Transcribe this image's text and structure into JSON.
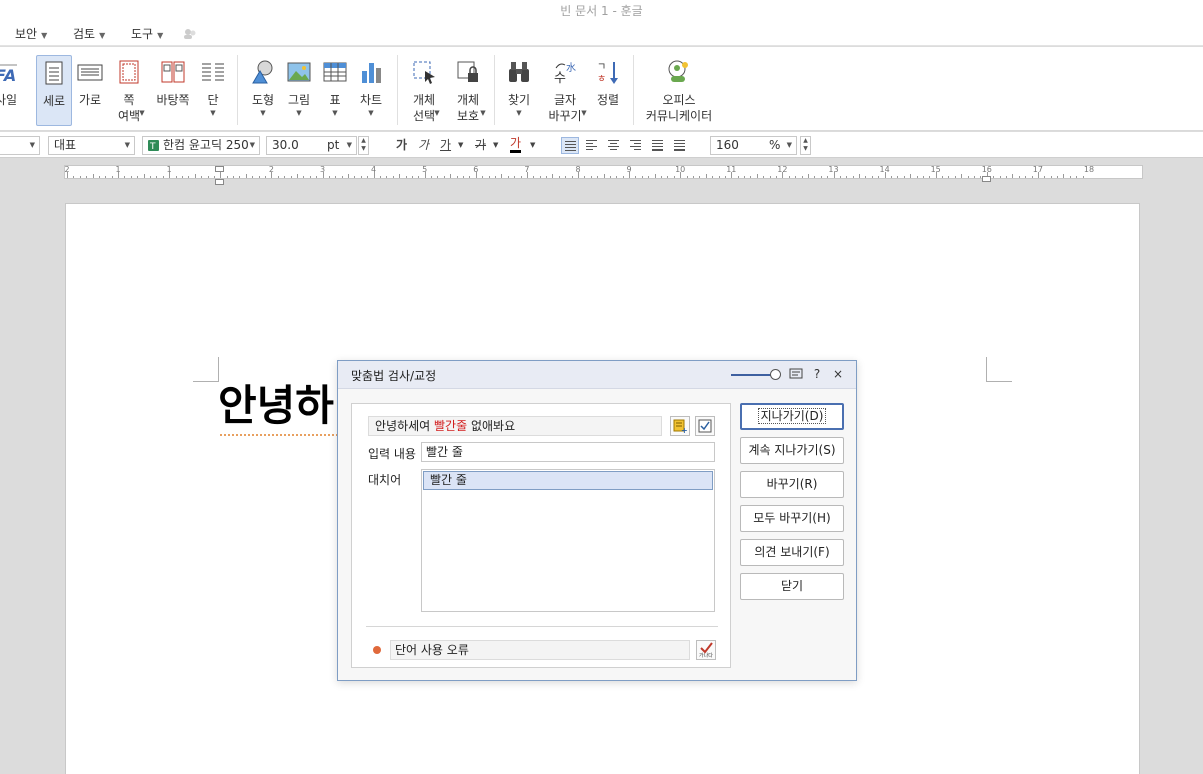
{
  "window": {
    "title": "빈 문서 1 - 훈글"
  },
  "menu": [
    {
      "id": "security",
      "label": "보안"
    },
    {
      "id": "review",
      "label": "검토"
    },
    {
      "id": "tools",
      "label": "도구"
    }
  ],
  "ribbon": {
    "partial_left": "사일",
    "buttons": {
      "vertical": "세로",
      "horizontal": "가로",
      "page_margin": "쪽\n여백",
      "background": "바탕쪽",
      "column": "단",
      "shape": "도형",
      "picture": "그림",
      "table": "표",
      "chart": "차트",
      "object_select": "개체\n선택",
      "object_protect": "개체\n보호",
      "find": "찾기",
      "replace": "글자\n바꾸기",
      "sort": "정렬",
      "office_communicator": "오피스\n커뮤니케이터"
    }
  },
  "format_bar": {
    "style": "대표",
    "font": "한컴 윤고딕 250",
    "size": "30.0",
    "size_unit": "pt",
    "char_buttons": [
      "가",
      "가",
      "가",
      "가",
      "가"
    ],
    "line_spacing": "160",
    "line_spacing_unit": "%"
  },
  "ruler": {
    "labels": [
      "2",
      "1",
      "1",
      "1",
      "2",
      "3",
      "4",
      "5",
      "6",
      "7",
      "8",
      "9",
      "10",
      "11",
      "12",
      "13",
      "14",
      "15",
      "16",
      "17",
      "18"
    ]
  },
  "document": {
    "visible_text": "안녕하"
  },
  "dialog": {
    "title": "맞춤법 검사/교정",
    "tb_help": "?",
    "tb_close": "×",
    "sentence_before": "안녕하세여 ",
    "sentence_error": "빨간줄",
    "sentence_after": " 없애봐요",
    "input_label": "입력 내용",
    "input_value": "빨간 줄",
    "suggestion_label": "대치어",
    "suggestions": [
      "빨간 줄"
    ],
    "status_text": "단어 사용 오류",
    "buttons": {
      "skip": "지나가기(D)",
      "skip_all": "계속 지나가기(S)",
      "replace": "바꾸기(R)",
      "replace_all": "모두 바꾸기(H)",
      "feedback": "의견 보내기(F)",
      "close": "닫기"
    },
    "colors": {
      "error": "#d21c1c",
      "status_dot": "#e0693b",
      "accent": "#4a6fb0"
    }
  }
}
